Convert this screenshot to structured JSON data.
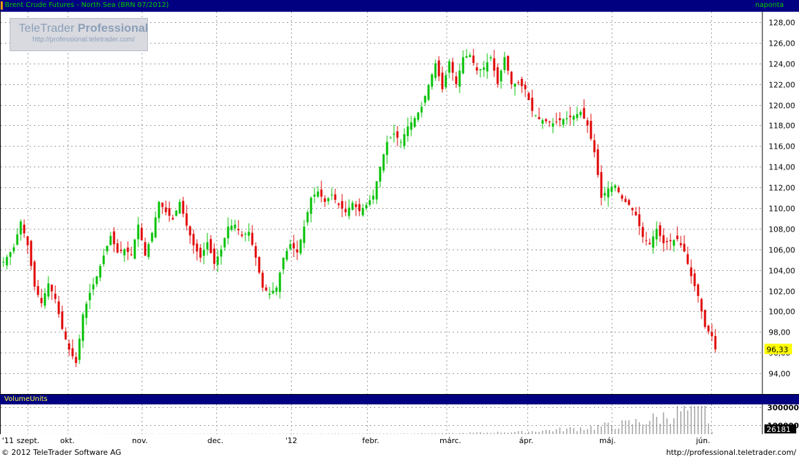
{
  "window": {
    "title": "Brent Crude Futures - North Sea (BRN 07/2012)",
    "period": "naponta",
    "volume_label": "VolumeUnits",
    "copyright": "© 2012 TeleTrader Software AG",
    "footer_url": "http://professional.teletrader.com/"
  },
  "watermark": {
    "brand": "TeleTrader",
    "brand_bold": "Professional",
    "url": "http://professional.teletrader.com/"
  },
  "colors": {
    "up": "#00c000",
    "down": "#e00000",
    "panel": "#ffffff",
    "frame": "#000080",
    "last_price_bg": "#ffff00"
  },
  "chart_data": [
    {
      "type": "candlestick",
      "title": "Brent Crude Futures - North Sea (BRN 07/2012)",
      "x_labels": [
        "'11",
        "szept.",
        "okt.",
        "nov.",
        "dec.",
        "'12",
        "febr.",
        "márc.",
        "ápr.",
        "máj.",
        "jún."
      ],
      "y_ticks": [
        "128,00",
        "126,00",
        "124,00",
        "122,00",
        "120,00",
        "118,00",
        "116,00",
        "114,00",
        "112,00",
        "110,00",
        "108,00",
        "106,00",
        "104,00",
        "102,00",
        "100,00",
        "98,00",
        "96,00",
        "94,00"
      ],
      "ylim": [
        92.0,
        129.0
      ],
      "last_price": "96,33",
      "grid": true,
      "close_anchors": [
        [
          0,
          104.8
        ],
        [
          3,
          106.2
        ],
        [
          5,
          108.7
        ],
        [
          7,
          106.4
        ],
        [
          9,
          102.4
        ],
        [
          11,
          100.8
        ],
        [
          13,
          102.7
        ],
        [
          15,
          101.2
        ],
        [
          17,
          98.3
        ],
        [
          19,
          96.3
        ],
        [
          21,
          95.0
        ],
        [
          23,
          99.7
        ],
        [
          25,
          101.8
        ],
        [
          27,
          103.4
        ],
        [
          29,
          105.4
        ],
        [
          31,
          107.3
        ],
        [
          33,
          105.7
        ],
        [
          35,
          106.0
        ],
        [
          37,
          105.5
        ],
        [
          39,
          108.4
        ],
        [
          41,
          105.4
        ],
        [
          43,
          107.6
        ],
        [
          45,
          110.6
        ],
        [
          47,
          109.6
        ],
        [
          49,
          108.9
        ],
        [
          51,
          110.6
        ],
        [
          53,
          108.3
        ],
        [
          55,
          106.4
        ],
        [
          57,
          105.2
        ],
        [
          59,
          106.7
        ],
        [
          61,
          104.6
        ],
        [
          63,
          106.0
        ],
        [
          65,
          108.2
        ],
        [
          67,
          108.4
        ],
        [
          69,
          107.3
        ],
        [
          71,
          107.7
        ],
        [
          73,
          105.2
        ],
        [
          75,
          102.3
        ],
        [
          77,
          101.7
        ],
        [
          79,
          102.3
        ],
        [
          81,
          105.2
        ],
        [
          83,
          106.5
        ],
        [
          85,
          105.7
        ],
        [
          87,
          108.2
        ],
        [
          89,
          111.0
        ],
        [
          91,
          111.6
        ],
        [
          93,
          110.6
        ],
        [
          95,
          111.3
        ],
        [
          97,
          110.3
        ],
        [
          99,
          109.6
        ],
        [
          101,
          110.5
        ],
        [
          103,
          109.7
        ],
        [
          105,
          110.3
        ],
        [
          107,
          111.2
        ],
        [
          109,
          114.0
        ],
        [
          111,
          116.4
        ],
        [
          113,
          117.2
        ],
        [
          115,
          116.4
        ],
        [
          117,
          117.9
        ],
        [
          119,
          118.7
        ],
        [
          121,
          119.8
        ],
        [
          123,
          121.9
        ],
        [
          125,
          124.0
        ],
        [
          127,
          121.5
        ],
        [
          129,
          124.2
        ],
        [
          131,
          122.0
        ],
        [
          133,
          124.6
        ],
        [
          135,
          124.8
        ],
        [
          137,
          123.3
        ],
        [
          139,
          123.6
        ],
        [
          141,
          124.6
        ],
        [
          143,
          122.0
        ],
        [
          145,
          124.6
        ],
        [
          147,
          122.0
        ],
        [
          149,
          122.1
        ],
        [
          151,
          121.5
        ],
        [
          153,
          119.4
        ],
        [
          155,
          118.6
        ],
        [
          157,
          118.4
        ],
        [
          159,
          118.2
        ],
        [
          161,
          118.5
        ],
        [
          163,
          118.7
        ],
        [
          165,
          118.9
        ],
        [
          167,
          119.3
        ],
        [
          169,
          118.0
        ],
        [
          171,
          115.4
        ],
        [
          173,
          111.0
        ],
        [
          175,
          111.9
        ],
        [
          177,
          112.2
        ],
        [
          179,
          110.9
        ],
        [
          181,
          110.3
        ],
        [
          183,
          109.3
        ],
        [
          185,
          107.2
        ],
        [
          187,
          106.5
        ],
        [
          189,
          108.0
        ],
        [
          191,
          106.6
        ],
        [
          193,
          106.8
        ],
        [
          195,
          107.0
        ],
        [
          197,
          105.8
        ],
        [
          199,
          103.4
        ],
        [
          201,
          101.5
        ],
        [
          203,
          98.5
        ],
        [
          205,
          97.6
        ],
        [
          206,
          96.33
        ]
      ],
      "series": [
        {
          "values": "daily OHLC, volume in VolumeUnits"
        }
      ]
    },
    {
      "type": "bar",
      "title": "VolumeUnits",
      "y_ticks": [
        "300000",
        "100000"
      ],
      "last_value": "26181",
      "volume_anchors": [
        [
          0,
          0
        ],
        [
          40,
          2000
        ],
        [
          80,
          3000
        ],
        [
          110,
          5000
        ],
        [
          130,
          9000
        ],
        [
          150,
          25000
        ],
        [
          165,
          60000
        ],
        [
          180,
          110000
        ],
        [
          190,
          180000
        ],
        [
          196,
          260000
        ],
        [
          200,
          230000
        ],
        [
          203,
          300000
        ],
        [
          205,
          26181
        ]
      ]
    }
  ]
}
